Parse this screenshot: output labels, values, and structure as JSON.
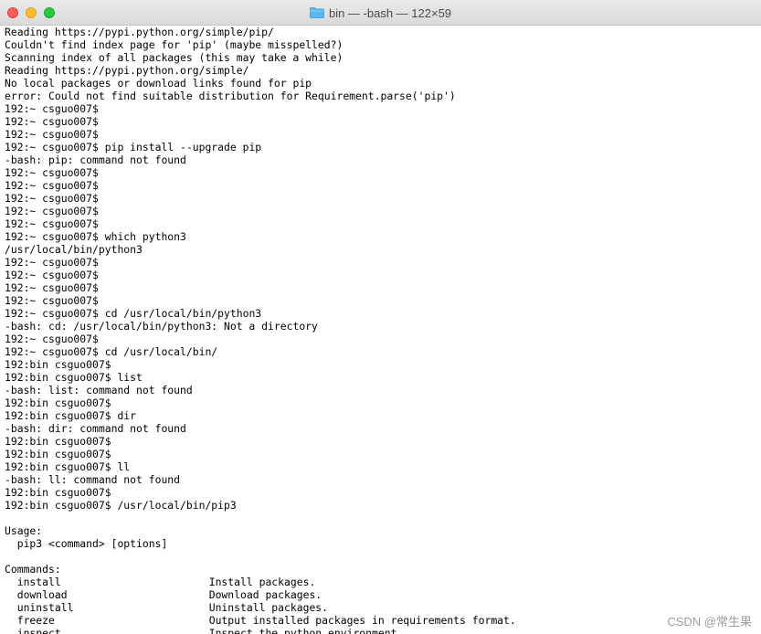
{
  "window": {
    "title": "bin — -bash — 122×59",
    "folder_icon": "folder-icon"
  },
  "colors": {
    "close": "#ff5f57",
    "minimize": "#febc2e",
    "maximize": "#28c840",
    "folder": "#59b7f2",
    "terminal_background": "#ffffff",
    "terminal_text": "#000000"
  },
  "terminal": {
    "lines": [
      "Reading https://pypi.python.org/simple/pip/",
      "Couldn't find index page for 'pip' (maybe misspelled?)",
      "Scanning index of all packages (this may take a while)",
      "Reading https://pypi.python.org/simple/",
      "No local packages or download links found for pip",
      "error: Could not find suitable distribution for Requirement.parse('pip')",
      "192:~ csguo007$",
      "192:~ csguo007$",
      "192:~ csguo007$",
      "192:~ csguo007$ pip install --upgrade pip",
      "-bash: pip: command not found",
      "192:~ csguo007$",
      "192:~ csguo007$",
      "192:~ csguo007$",
      "192:~ csguo007$",
      "192:~ csguo007$",
      "192:~ csguo007$ which python3",
      "/usr/local/bin/python3",
      "192:~ csguo007$",
      "192:~ csguo007$",
      "192:~ csguo007$",
      "192:~ csguo007$",
      "192:~ csguo007$ cd /usr/local/bin/python3",
      "-bash: cd: /usr/local/bin/python3: Not a directory",
      "192:~ csguo007$",
      "192:~ csguo007$ cd /usr/local/bin/",
      "192:bin csguo007$",
      "192:bin csguo007$ list",
      "-bash: list: command not found",
      "192:bin csguo007$",
      "192:bin csguo007$ dir",
      "-bash: dir: command not found",
      "192:bin csguo007$",
      "192:bin csguo007$",
      "192:bin csguo007$ ll",
      "-bash: ll: command not found",
      "192:bin csguo007$",
      "192:bin csguo007$ /usr/local/bin/pip3",
      "",
      "Usage:",
      "  pip3 <command> [options]",
      "",
      "Commands:"
    ],
    "marked": [
      0,
      0,
      0,
      0,
      0,
      0,
      0,
      0,
      0,
      1,
      1,
      0,
      1,
      0,
      1,
      0,
      0,
      0,
      0,
      1,
      1,
      1,
      1,
      1,
      0,
      1,
      1,
      1,
      1,
      1,
      1,
      0,
      1,
      1,
      1,
      1,
      1,
      0,
      1,
      1,
      1,
      1,
      0
    ],
    "commands": [
      {
        "name": "install",
        "desc": "Install packages.",
        "marked": 1
      },
      {
        "name": "download",
        "desc": "Download packages.",
        "marked": 1
      },
      {
        "name": "uninstall",
        "desc": "Uninstall packages.",
        "marked": 0
      },
      {
        "name": "freeze",
        "desc": "Output installed packages in requirements format.",
        "marked": 1
      },
      {
        "name": "inspect",
        "desc": "Inspect the python environment",
        "marked": 0
      }
    ]
  },
  "watermark": "CSDN @常生果"
}
